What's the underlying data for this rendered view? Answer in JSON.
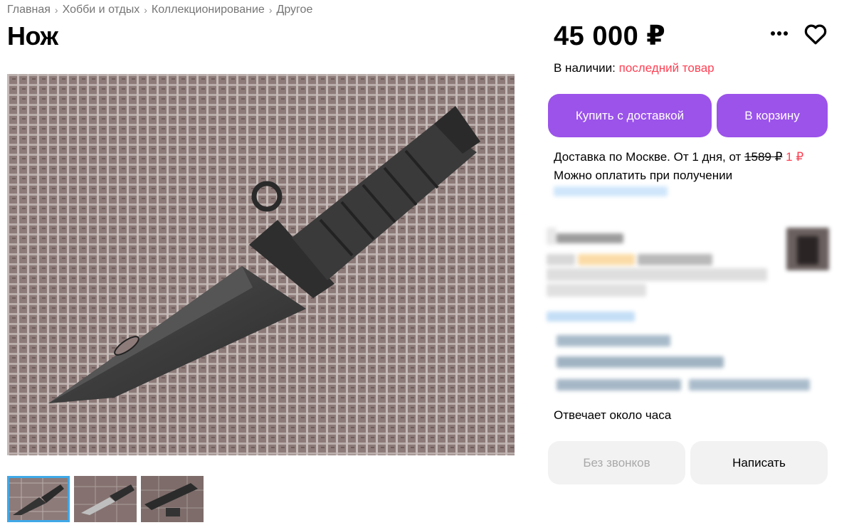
{
  "breadcrumb": [
    "Главная",
    "Хобби и отдых",
    "Коллекционирование",
    "Другое"
  ],
  "breadcrumb_separator": "›",
  "title": "Нож",
  "price": "45 000 ₽",
  "stock": {
    "label": "В наличии: ",
    "status": "последний товар"
  },
  "buttons": {
    "buy_delivery": "Купить с доставкой",
    "add_to_cart": "В корзину",
    "no_calls": "Без звонков",
    "write": "Написать"
  },
  "delivery": {
    "line_prefix": "Доставка по Москве. От 1 дня, от ",
    "old_price": "1589 ₽",
    "new_price": "1 ₽",
    "payment": "Можно оплатить при получении"
  },
  "seller": {
    "reply_time": "Отвечает около часа"
  },
  "icons": {
    "more": "more-dots-icon",
    "favorite": "heart-icon"
  },
  "colors": {
    "accent": "#9b53ea",
    "sale": "#ff4053",
    "muted_button": "#f2f2f2",
    "thumb_active": "#3fa8e8"
  },
  "thumbnails": [
    "knife-photo-1",
    "knife-photo-2",
    "knife-photo-3"
  ],
  "active_thumbnail": 0
}
